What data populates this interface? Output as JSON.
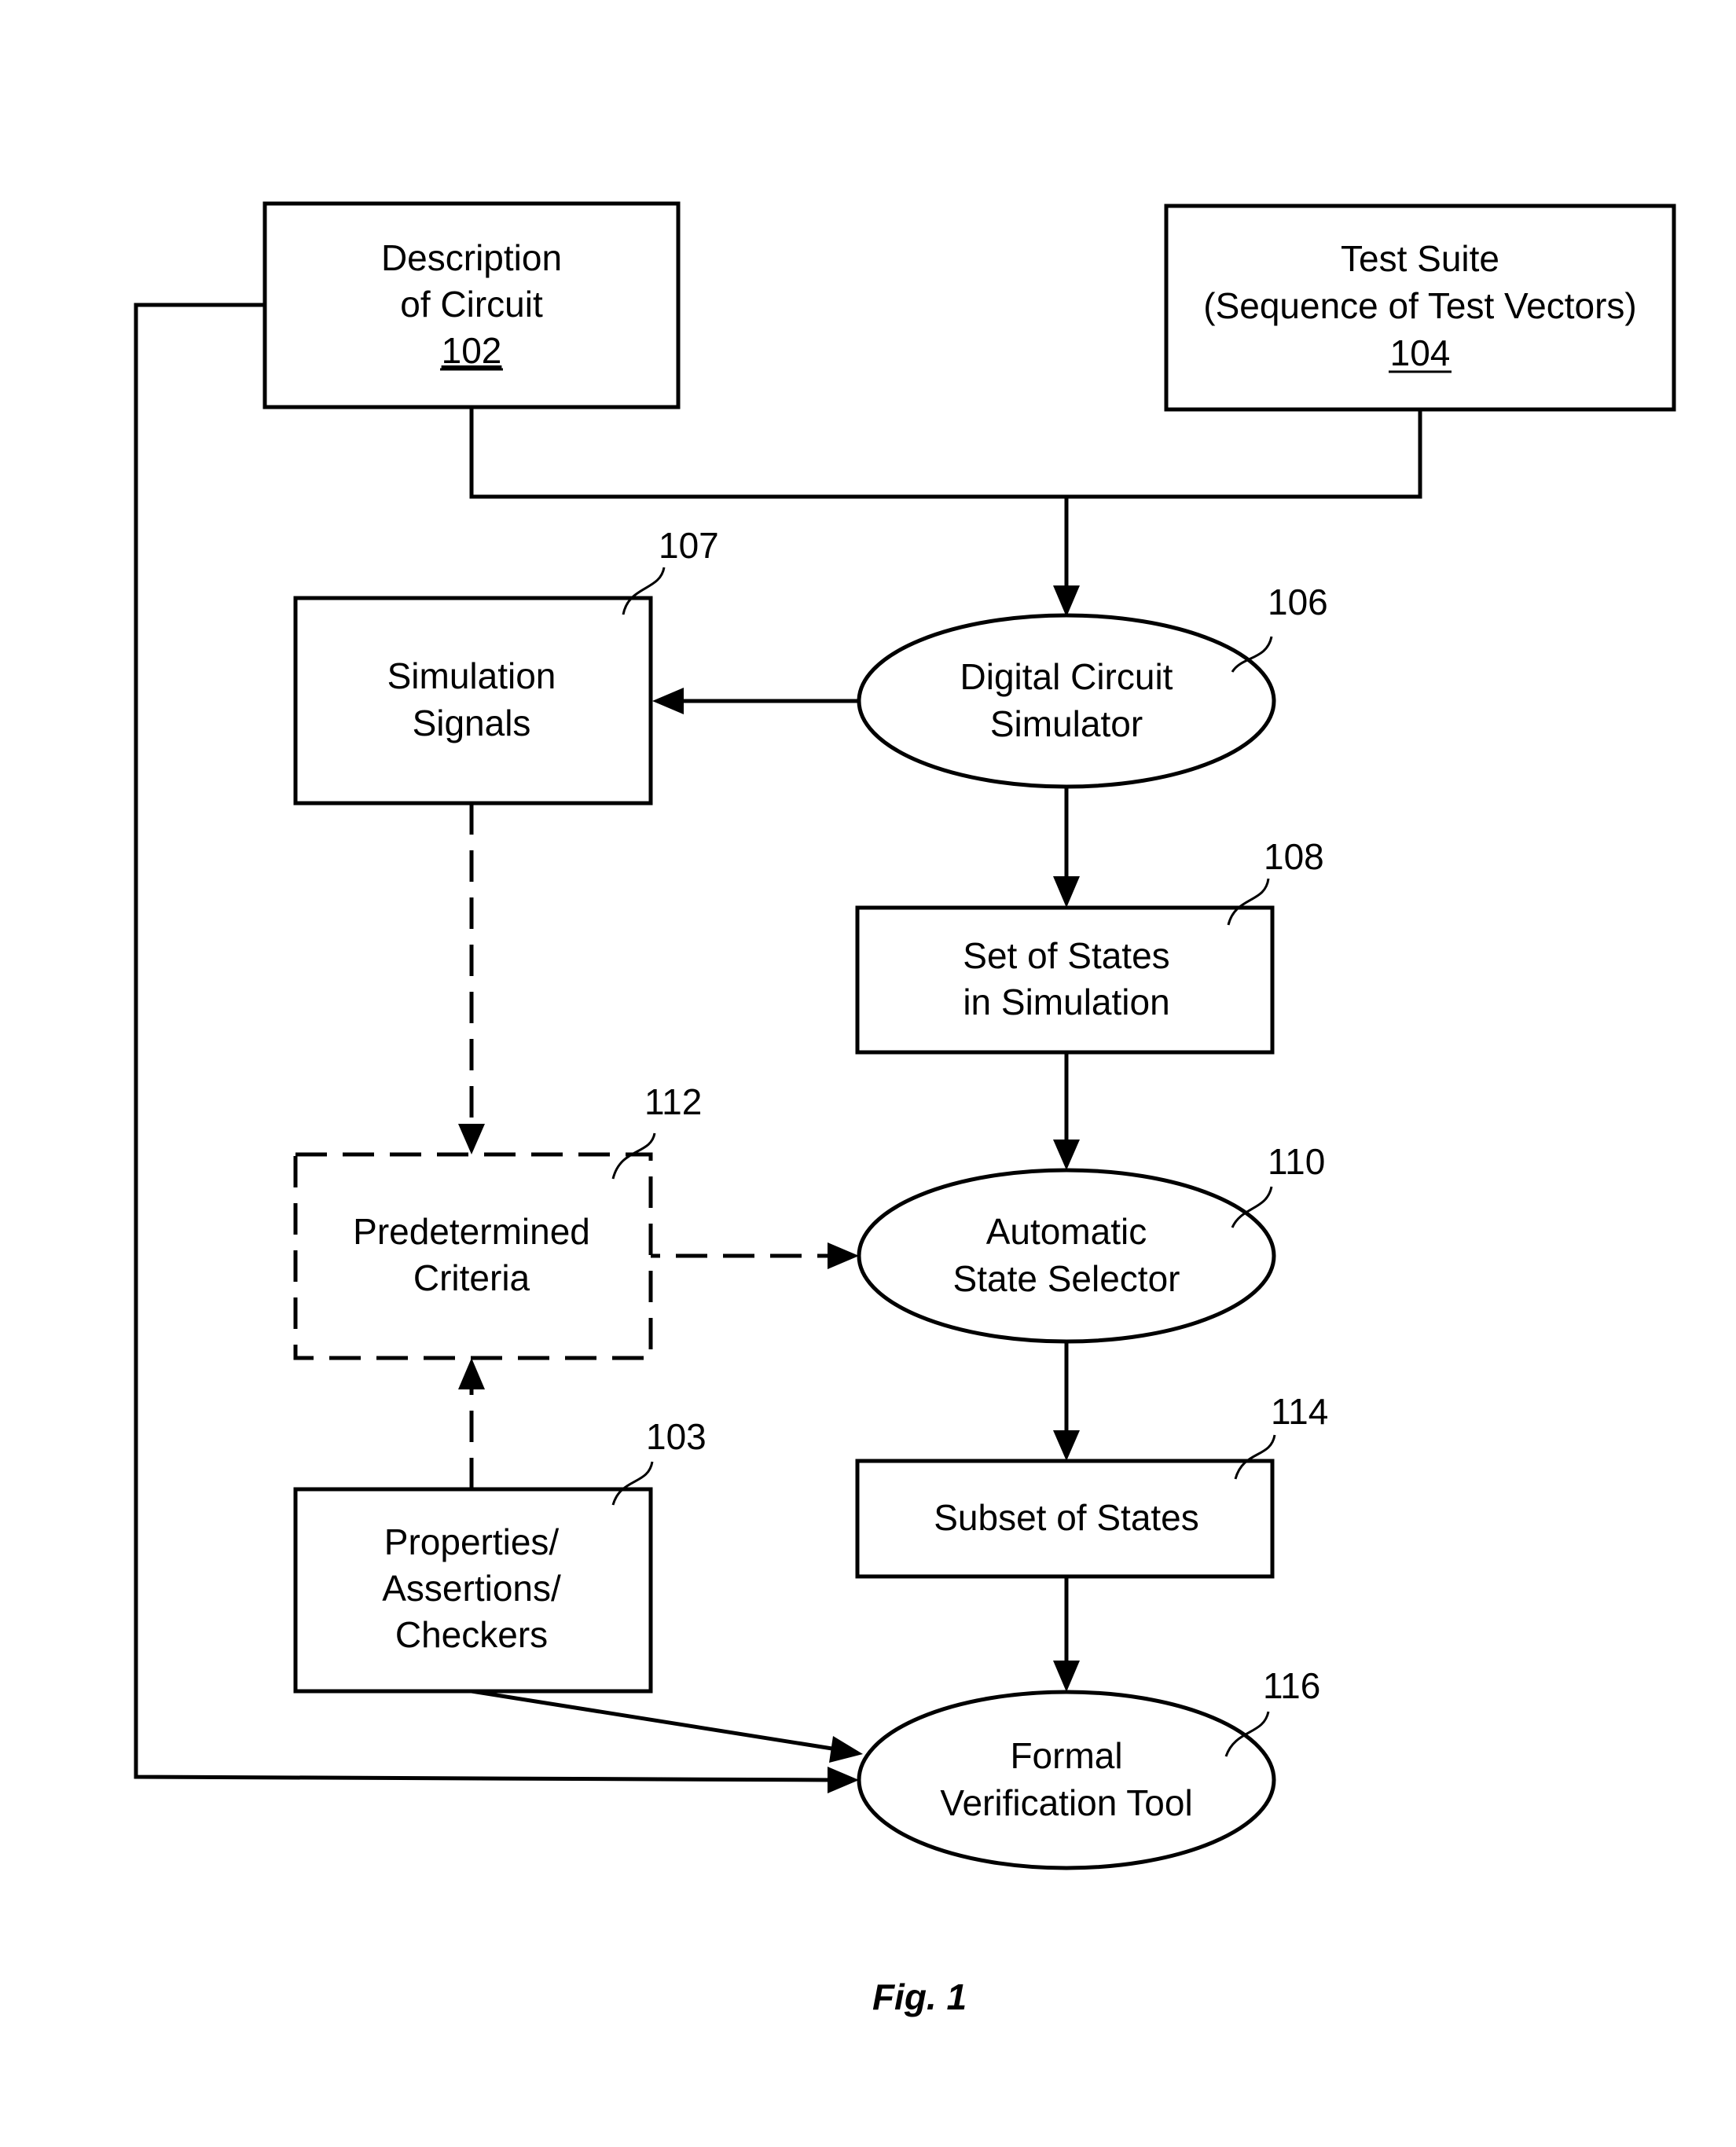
{
  "figure": {
    "caption": "Fig. 1",
    "nodes": {
      "n102": {
        "lines": [
          "Description",
          "of Circuit"
        ],
        "ref": "102",
        "ref_underlined": true,
        "shape": "rectangle"
      },
      "n104": {
        "lines": [
          "Test Suite",
          "(Sequence of Test Vectors)"
        ],
        "ref": "104",
        "ref_underlined": true,
        "shape": "rectangle"
      },
      "n106": {
        "lines": [
          "Digital Circuit",
          "Simulator"
        ],
        "ref": "106",
        "shape": "ellipse"
      },
      "n107": {
        "lines": [
          "Simulation",
          "Signals"
        ],
        "ref": "107",
        "shape": "rectangle"
      },
      "n108": {
        "lines": [
          "Set of States",
          "in Simulation"
        ],
        "ref": "108",
        "shape": "rectangle"
      },
      "n110": {
        "lines": [
          "Automatic",
          "State Selector"
        ],
        "ref": "110",
        "shape": "ellipse"
      },
      "n112": {
        "lines": [
          "Predetermined",
          "Criteria"
        ],
        "ref": "112",
        "shape": "dashed-rectangle"
      },
      "n103": {
        "lines": [
          "Properties/",
          "Assertions/",
          "Checkers"
        ],
        "ref": "103",
        "shape": "rectangle"
      },
      "n114": {
        "lines": [
          "Subset of States"
        ],
        "ref": "114",
        "shape": "rectangle"
      },
      "n116": {
        "lines": [
          "Formal",
          "Verification Tool"
        ],
        "ref": "116",
        "shape": "ellipse"
      }
    },
    "edges": [
      {
        "from": "102",
        "to": "106",
        "style": "solid"
      },
      {
        "from": "104",
        "to": "106",
        "style": "solid"
      },
      {
        "from": "106",
        "to": "107",
        "style": "solid"
      },
      {
        "from": "106",
        "to": "108",
        "style": "solid"
      },
      {
        "from": "107",
        "to": "112",
        "style": "dashed"
      },
      {
        "from": "108",
        "to": "110",
        "style": "solid"
      },
      {
        "from": "112",
        "to": "110",
        "style": "dashed"
      },
      {
        "from": "103",
        "to": "112",
        "style": "dashed"
      },
      {
        "from": "110",
        "to": "114",
        "style": "solid"
      },
      {
        "from": "114",
        "to": "116",
        "style": "solid"
      },
      {
        "from": "103",
        "to": "116",
        "style": "solid"
      },
      {
        "from": "102",
        "to": "116",
        "style": "solid"
      }
    ]
  }
}
